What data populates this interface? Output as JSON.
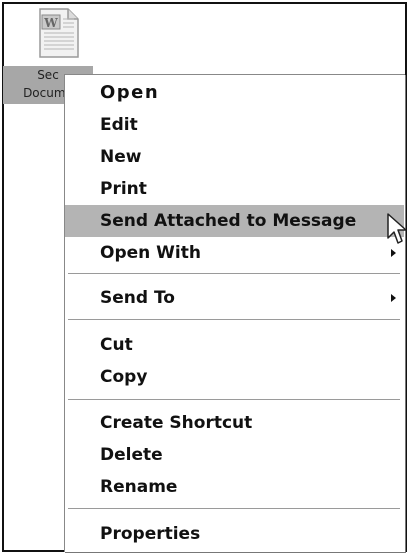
{
  "desktop": {
    "file_icon": "word-document-icon",
    "file_label_line1": "Sec",
    "file_label_line2": "Docume"
  },
  "menu": {
    "items": [
      {
        "label": "Open"
      },
      {
        "label": "Edit"
      },
      {
        "label": "New"
      },
      {
        "label": "Print"
      },
      {
        "label": "Send Attached to Message"
      },
      {
        "label": "Open With"
      },
      {
        "label": "Send To"
      },
      {
        "label": "Cut"
      },
      {
        "label": "Copy"
      },
      {
        "label": "Create Shortcut"
      },
      {
        "label": "Delete"
      },
      {
        "label": "Rename"
      },
      {
        "label": "Properties"
      }
    ],
    "default_item": "Open",
    "highlighted_item": "Send Attached to Message",
    "submenu_items": [
      "Open With",
      "Send To"
    ]
  },
  "colors": {
    "highlight": "#b4b4b4",
    "selection_label_bg": "#a7a7a7"
  },
  "cursor": "mouse-pointer-icon"
}
